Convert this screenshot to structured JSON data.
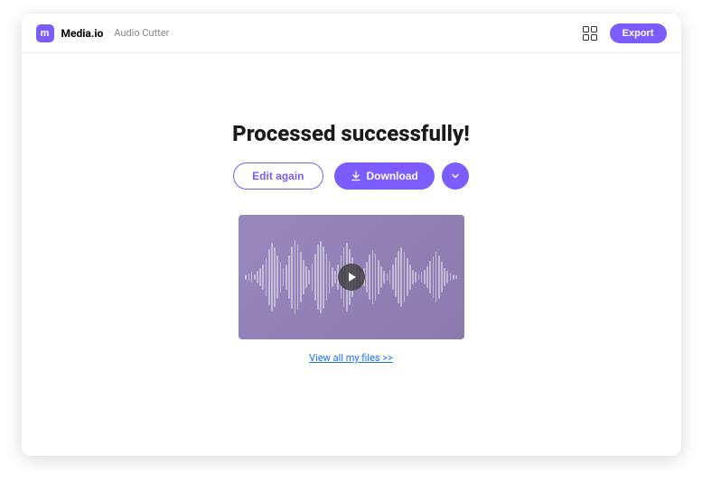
{
  "header": {
    "brand": "Media.io",
    "subtitle": "Audio Cutter",
    "export_label": "Export",
    "logo_text": "m"
  },
  "main": {
    "title": "Processed successfully!",
    "edit_label": "Edit again",
    "download_label": "Download",
    "view_files_label": "View all my files >>"
  },
  "colors": {
    "accent": "#7c5cff"
  }
}
